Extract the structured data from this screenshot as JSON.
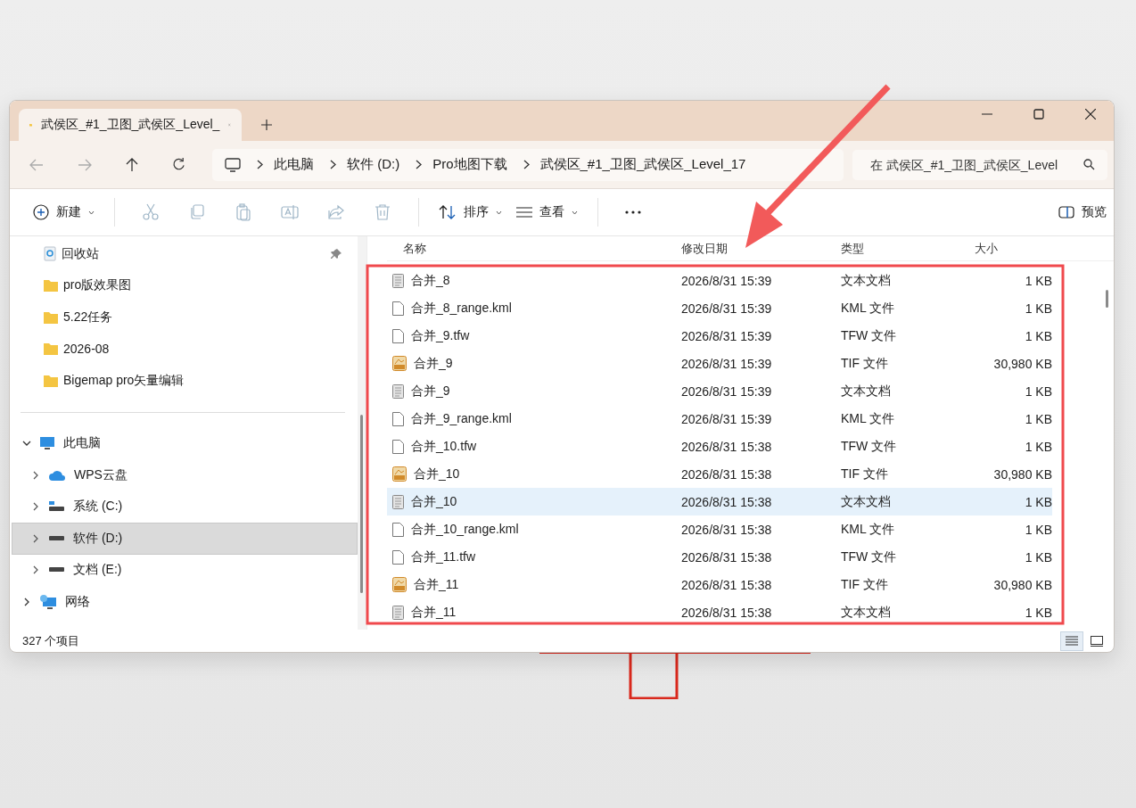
{
  "window": {
    "tab_title": "武侯区_#1_卫图_武侯区_Level_"
  },
  "address": {
    "crumbs": [
      "此电脑",
      "软件 (D:)",
      "Pro地图下载",
      "武侯区_#1_卫图_武侯区_Level_17"
    ]
  },
  "search": {
    "placeholder": "在 武侯区_#1_卫图_武侯区_Level"
  },
  "toolbar": {
    "new_label": "新建",
    "actions": [
      {
        "kind": "cut",
        "disabled": true
      },
      {
        "kind": "copy",
        "disabled": true
      },
      {
        "kind": "paste",
        "disabled": true
      },
      {
        "kind": "rename",
        "disabled": true
      },
      {
        "kind": "share",
        "disabled": true
      },
      {
        "kind": "delete",
        "disabled": true
      }
    ],
    "sort_label": "排序",
    "view_label": "查看",
    "preview_label": "预览"
  },
  "sidebar": {
    "quick": [
      {
        "label": "回收站",
        "kind": "recycle",
        "pinned": true
      },
      {
        "label": "pro版效果图",
        "kind": "folder",
        "pinned": false
      },
      {
        "label": "5.22任务",
        "kind": "folder",
        "pinned": false
      },
      {
        "label": "2026-08",
        "kind": "folder",
        "pinned": false
      },
      {
        "label": "Bigemap pro矢量编辑",
        "kind": "folder",
        "pinned": false
      }
    ],
    "tree": [
      {
        "label": "此电脑",
        "kind": "pc",
        "expanded": true,
        "selected": false,
        "children": [
          {
            "label": "WPS云盘",
            "kind": "cloud",
            "expanded": false,
            "selected": false
          },
          {
            "label": "系统 (C:)",
            "kind": "sysdrive",
            "expanded": false,
            "selected": false
          },
          {
            "label": "软件 (D:)",
            "kind": "drive",
            "expanded": false,
            "selected": true
          },
          {
            "label": "文档 (E:)",
            "kind": "drive",
            "expanded": false,
            "selected": false
          }
        ]
      },
      {
        "label": "网络",
        "kind": "network",
        "expanded": false,
        "selected": false
      }
    ]
  },
  "table": {
    "columns": [
      "名称",
      "修改日期",
      "类型",
      "大小"
    ],
    "rows": [
      {
        "kind": "text",
        "name": "合并_8",
        "date": "2026/8/31 15:39",
        "type": "文本文档",
        "size": "1 KB",
        "selected": false
      },
      {
        "kind": "file",
        "name": "合并_8_range.kml",
        "date": "2026/8/31 15:39",
        "type": "KML 文件",
        "size": "1 KB",
        "selected": false
      },
      {
        "kind": "file",
        "name": "合并_9.tfw",
        "date": "2026/8/31 15:39",
        "type": "TFW 文件",
        "size": "1 KB",
        "selected": false
      },
      {
        "kind": "tif",
        "name": "合并_9",
        "date": "2026/8/31 15:39",
        "type": "TIF 文件",
        "size": "30,980 KB",
        "selected": false
      },
      {
        "kind": "text",
        "name": "合并_9",
        "date": "2026/8/31 15:39",
        "type": "文本文档",
        "size": "1 KB",
        "selected": false
      },
      {
        "kind": "file",
        "name": "合并_9_range.kml",
        "date": "2026/8/31 15:39",
        "type": "KML 文件",
        "size": "1 KB",
        "selected": false
      },
      {
        "kind": "file",
        "name": "合并_10.tfw",
        "date": "2026/8/31 15:38",
        "type": "TFW 文件",
        "size": "1 KB",
        "selected": false
      },
      {
        "kind": "tif",
        "name": "合并_10",
        "date": "2026/8/31 15:38",
        "type": "TIF 文件",
        "size": "30,980 KB",
        "selected": false
      },
      {
        "kind": "text",
        "name": "合并_10",
        "date": "2026/8/31 15:38",
        "type": "文本文档",
        "size": "1 KB",
        "selected": true
      },
      {
        "kind": "file",
        "name": "合并_10_range.kml",
        "date": "2026/8/31 15:38",
        "type": "KML 文件",
        "size": "1 KB",
        "selected": false
      },
      {
        "kind": "file",
        "name": "合并_11.tfw",
        "date": "2026/8/31 15:38",
        "type": "TFW 文件",
        "size": "1 KB",
        "selected": false
      },
      {
        "kind": "tif",
        "name": "合并_11",
        "date": "2026/8/31 15:38",
        "type": "TIF 文件",
        "size": "30,980 KB",
        "selected": false
      },
      {
        "kind": "text",
        "name": "合并_11",
        "date": "2026/8/31 15:38",
        "type": "文本文档",
        "size": "1 KB",
        "selected": false
      }
    ]
  },
  "status_bar": {
    "count": "327 个项目",
    "views": [
      {
        "kind": "details",
        "selected": true
      },
      {
        "kind": "tiles",
        "selected": false
      }
    ]
  }
}
